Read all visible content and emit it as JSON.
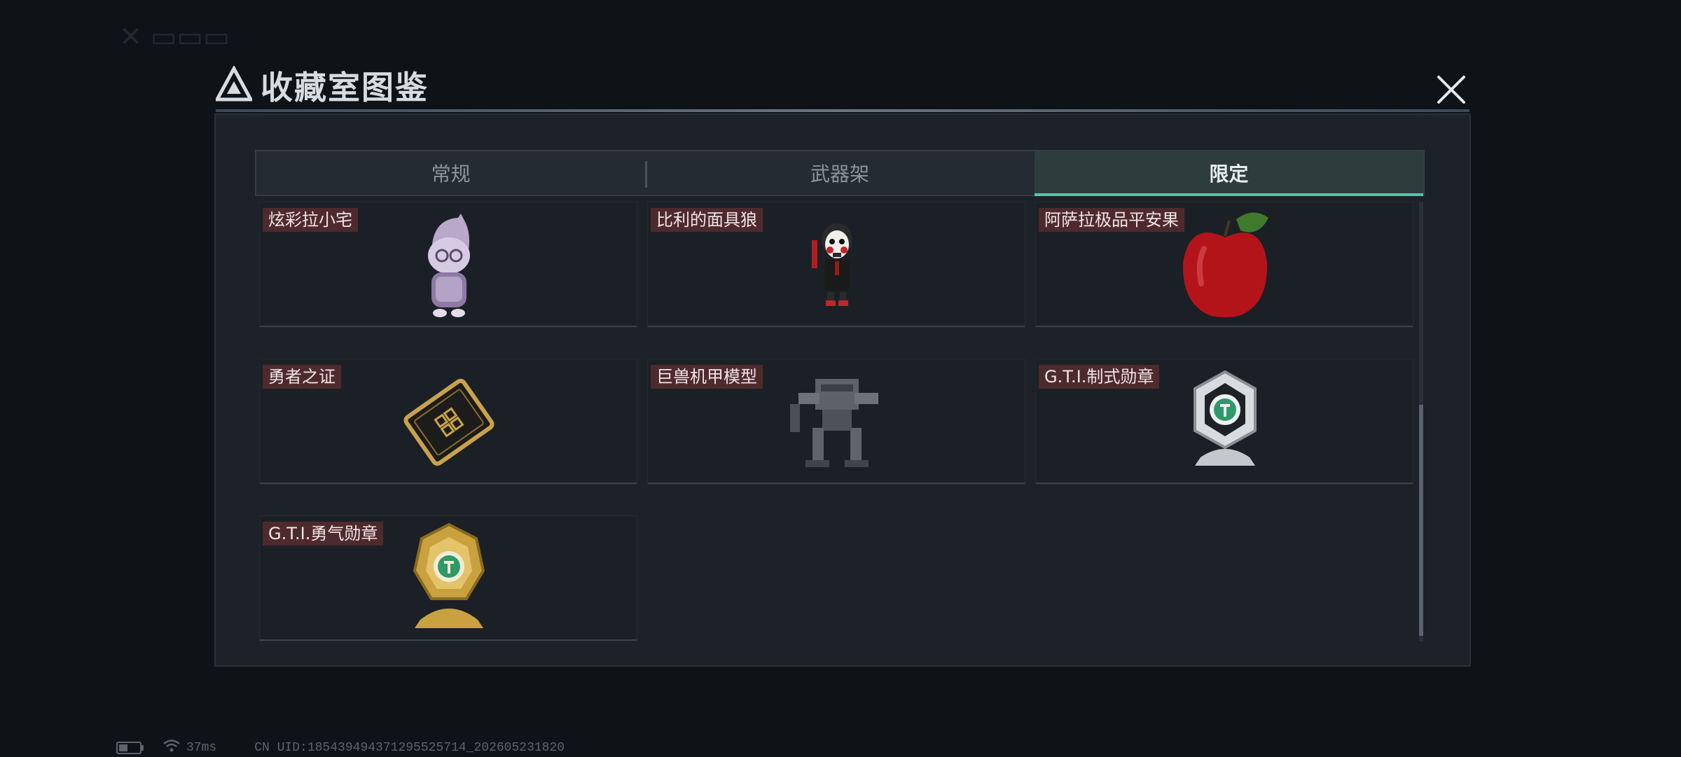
{
  "modal": {
    "title": "收藏室图鉴"
  },
  "tabs": [
    {
      "label": "常规",
      "active": false
    },
    {
      "label": "武器架",
      "active": false
    },
    {
      "label": "限定",
      "active": true
    }
  ],
  "items": [
    {
      "label": "炫彩拉小宅",
      "icon": "purple-doll-figure"
    },
    {
      "label": "比利的面具狼",
      "icon": "puppet-mask-figure"
    },
    {
      "label": "阿萨拉极品平安果",
      "icon": "red-apple"
    },
    {
      "label": "勇者之证",
      "icon": "gold-card"
    },
    {
      "label": "巨兽机甲模型",
      "icon": "mech-model"
    },
    {
      "label": "G.T.I.制式勋章",
      "icon": "silver-medal"
    },
    {
      "label": "G.T.I.勇气勋章",
      "icon": "gold-medal"
    }
  ],
  "status": {
    "ping": "37ms",
    "uid": "CN UID:1854394943712955257​14_202605231820"
  },
  "colors": {
    "accent": "#4fc9a7",
    "label_bg": "#4e2a2d",
    "panel_bg": "#1d2228"
  }
}
